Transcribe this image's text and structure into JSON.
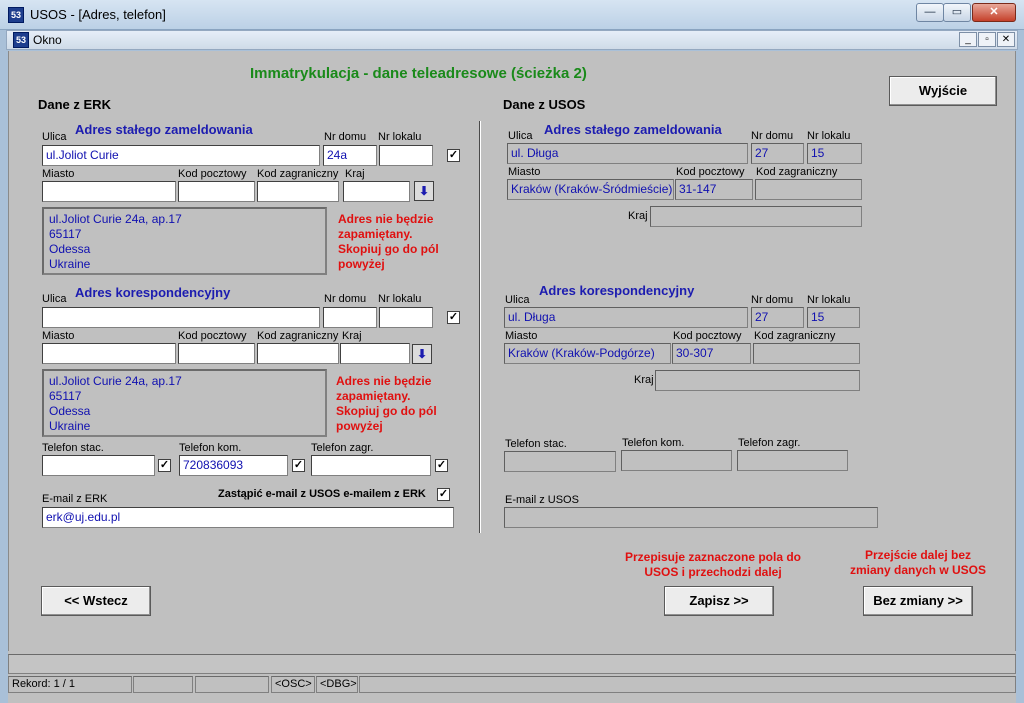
{
  "window": {
    "title": "USOS - [Adres, telefon]",
    "min": "—",
    "max": "▭",
    "close": "✕"
  },
  "mdi": {
    "title": "Okno",
    "min": "_",
    "restore": "▫",
    "close": "✕"
  },
  "page_title": "Immatrykulacja - dane teleadresowe (ścieżka 2)",
  "exit_button": "Wyjście",
  "erk": {
    "heading": "Dane z ERK",
    "permanent": {
      "section": "Adres stałego zameldowania",
      "street_label": "Ulica",
      "street": "ul.Joliot Curie",
      "house_label": "Nr domu",
      "house": "24a",
      "flat_label": "Nr lokalu",
      "flat": "",
      "checked": "✓",
      "city_label": "Miasto",
      "city": "",
      "postal_label": "Kod pocztowy",
      "postal": "",
      "foreign_label": "Kod zagraniczny",
      "foreign": "",
      "country_label": "Kraj",
      "country": "",
      "copy_icon": "⬇",
      "summary": [
        "ul.Joliot Curie 24a, ap.17",
        "65117",
        "Odessa",
        "Ukraine"
      ],
      "warning": [
        "Adres nie będzie",
        "zapamiętany.",
        "Skopiuj go do pól",
        "powyżej"
      ]
    },
    "mailing": {
      "section": "Adres korespondencyjny",
      "street_label": "Ulica",
      "street": "",
      "house_label": "Nr domu",
      "house": "",
      "flat_label": "Nr lokalu",
      "flat": "",
      "checked": "✓",
      "city_label": "Miasto",
      "city": "",
      "postal_label": "Kod pocztowy",
      "postal": "",
      "foreign_label": "Kod zagraniczny",
      "foreign": "",
      "country_label": "Kraj",
      "country": "",
      "copy_icon": "⬇",
      "summary": [
        "ul.Joliot Curie 24a, ap.17",
        "65117",
        "Odessa",
        "Ukraine"
      ],
      "warning": [
        "Adres nie będzie",
        "zapamiętany.",
        "Skopiuj go do pól",
        "powyżej"
      ]
    },
    "phone_label": "Telefon stac.",
    "phone": "",
    "mobile_label": "Telefon kom.",
    "mobile": "720836093",
    "foreign_phone_label": "Telefon zagr.",
    "foreign_phone": "",
    "checked": "✓",
    "email_label": "E-mail z ERK",
    "email": "erk@uj.edu.pl",
    "replace_email_label": "Zastąpić e-mail z USOS e-mailem z ERK"
  },
  "usos": {
    "heading": "Dane z USOS",
    "permanent": {
      "section": "Adres stałego zameldowania",
      "street_label": "Ulica",
      "street": "ul. Długa",
      "house_label": "Nr domu",
      "house": "27",
      "flat_label": "Nr lokalu",
      "flat": "15",
      "city_label": "Miasto",
      "city": "Kraków (Kraków-Śródmieście)",
      "postal_label": "Kod pocztowy",
      "postal": "31-147",
      "foreign_label": "Kod zagraniczny",
      "foreign": "",
      "country_label": "Kraj",
      "country": ""
    },
    "mailing": {
      "section": "Adres korespondencyjny",
      "street_label": "Ulica",
      "street": "ul. Długa",
      "house_label": "Nr domu",
      "house": "27",
      "flat_label": "Nr lokalu",
      "flat": "15",
      "city_label": "Miasto",
      "city": "Kraków (Kraków-Podgórze)",
      "postal_label": "Kod pocztowy",
      "postal": "30-307",
      "foreign_label": "Kod zagraniczny",
      "foreign": "",
      "country_label": "Kraj",
      "country": ""
    },
    "phone_label": "Telefon stac.",
    "phone": "",
    "mobile_label": "Telefon kom.",
    "mobile": "",
    "foreign_phone_label": "Telefon zagr.",
    "foreign_phone": "",
    "email_label": "E-mail z USOS",
    "email": ""
  },
  "notes": {
    "save": [
      "Przepisuje zaznaczone pola do",
      "USOS i przechodzi dalej"
    ],
    "nochange": [
      "Przejście dalej bez",
      "zmiany danych w USOS"
    ]
  },
  "buttons": {
    "back": "<< Wstecz",
    "save": "Zapisz >>",
    "nochange": "Bez zmiany >>"
  },
  "status": {
    "record": "Rekord: 1 / 1",
    "osc": "<OSC>",
    "dbg": "<DBG>"
  }
}
